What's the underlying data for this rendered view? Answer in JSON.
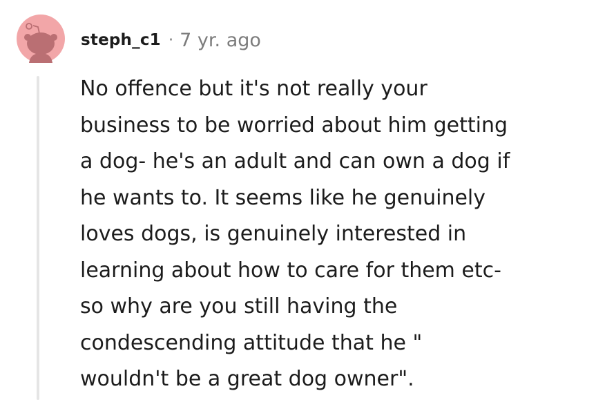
{
  "comment": {
    "author": "steph_c1",
    "separator": "·",
    "timestamp": "7 yr. ago",
    "body": "No offence but it's not really your\nbusiness to be worried about him getting\na dog- he's an adult and can own a dog if\nhe wants to. It seems like he genuinely\nloves dogs, is genuinely interested in\nlearning about how to care for them etc-\nso why are you still having the\ncondescending attitude that he \"\nwouldn't be a great dog owner\"."
  },
  "avatar": {
    "icon": "reddit-snoo-avatar-icon",
    "background_color": "#f2a6a8",
    "figure_color": "#ba6f73"
  },
  "colors": {
    "text": "#1c1c1c",
    "meta": "#7c7c7c",
    "thread_line": "#e5e5e5"
  }
}
